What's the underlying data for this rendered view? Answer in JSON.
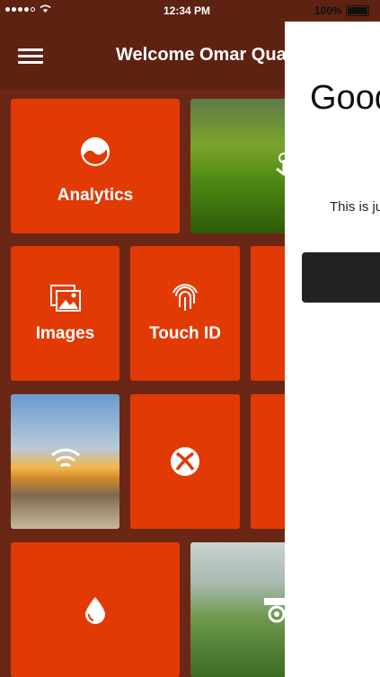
{
  "status_bar": {
    "time": "12:34 PM",
    "battery": "100%"
  },
  "header": {
    "title": "Welcome Omar Quaresma",
    "menu_icon": "hamburger-menu-icon"
  },
  "tiles": {
    "analytics": {
      "label": "Analytics",
      "icon": "analytics-icon"
    },
    "images": {
      "label": "Images",
      "icon": "images-icon"
    },
    "touch_id": {
      "label": "Touch ID",
      "icon": "fingerprint-icon"
    },
    "wifi_icon": "wifi-icon",
    "xbox_icon": "xbox-icon",
    "drop_icon": "water-drop-icon"
  },
  "side_panel": {
    "heading": "Good",
    "text": "This is ju"
  },
  "colors": {
    "tile": "#e23a05",
    "header": "#5e2213",
    "panel": "#ffffff"
  }
}
